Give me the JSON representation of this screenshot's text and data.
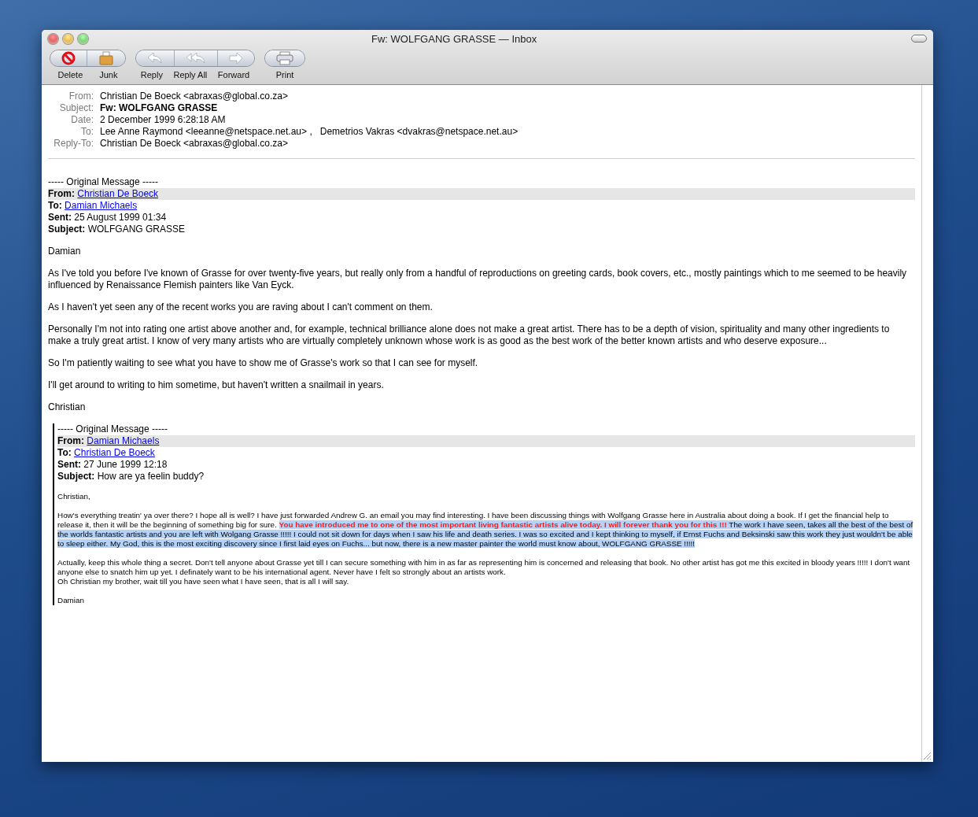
{
  "window": {
    "title": "Fw: WOLFGANG GRASSE — Inbox"
  },
  "toolbar": [
    {
      "buttons": [
        {
          "label": "Delete"
        },
        {
          "label": "Junk"
        }
      ]
    },
    {
      "buttons": [
        {
          "label": "Reply"
        },
        {
          "label": "Reply All"
        },
        {
          "label": "Forward"
        }
      ]
    },
    {
      "buttons": [
        {
          "label": "Print"
        }
      ]
    }
  ],
  "headers": [
    {
      "label": "From:",
      "value": "Christian De Boeck <abraxas@global.co.za>",
      "bold": false
    },
    {
      "label": "Subject:",
      "value": "Fw: WOLFGANG GRASSE",
      "bold": true
    },
    {
      "label": "Date:",
      "value": "2 December 1999 6:28:18 AM",
      "bold": false
    },
    {
      "label": "To:",
      "value": "Lee Anne Raymond <leeanne@netspace.net.au> ,   Demetrios Vakras <dvakras@netspace.net.au>",
      "bold": false
    },
    {
      "label": "Reply-To:",
      "value": "Christian De Boeck <abraxas@global.co.za>",
      "bold": false
    }
  ],
  "message": {
    "intro": "----- Original Message -----",
    "quote_headers": [
      {
        "label": "From:",
        "value": "Christian De Boeck",
        "link": true,
        "highlighted": true
      },
      {
        "label": "To:",
        "value": "Damian Michaels",
        "link": true,
        "highlighted": false
      },
      {
        "label": "Sent:",
        "value": "25 August 1999 01:34",
        "link": false,
        "highlighted": false
      },
      {
        "label": "Subject:",
        "value": "WOLFGANG GRASSE",
        "link": false,
        "highlighted": false
      }
    ],
    "paragraphs": [
      "Damian",
      "As I've told you before I've known of Grasse for over twenty-five years, but really only from a handful of reproductions on greeting cards, book covers, etc., mostly paintings which to me seemed to be heavily influenced by Renaissance Flemish painters like Van Eyck.",
      "As I haven't yet seen any of the recent works you are raving about I can't comment on them.",
      "Personally I'm not into rating one artist above another and, for example, technical brilliance alone does not make a great artist. There has to be a depth of vision, spirituality and many other ingredients to make a truly great artist. I know of very many artists who are virtually completely unknown whose work is as good as the best work of the better known artists and who deserve exposure...",
      "So I'm patiently waiting to see what you have to show me of Grasse's work so that I can see for myself.",
      "I'll get around to writing to him sometime, but haven't written a snailmail in years.",
      "Christian"
    ],
    "quoted": {
      "intro": "----- Original Message -----",
      "quote_headers": [
        {
          "label": "From:",
          "value": "Damian Michaels",
          "link": true,
          "highlighted": true
        },
        {
          "label": "To:",
          "value": "Christian De Boeck",
          "link": true,
          "highlighted": false
        },
        {
          "label": "Sent:",
          "value": "27 June 1999 12:18",
          "link": false,
          "highlighted": false
        },
        {
          "label": "Subject:",
          "value": "How are ya feelin buddy?",
          "link": false,
          "highlighted": false
        }
      ],
      "paragraphs": [
        {
          "segments": [
            {
              "text": "Christian,",
              "emphasis": false,
              "selected": false
            }
          ]
        },
        {
          "segments": [
            {
              "text": "How's everything treatin' ya over there? I hope all is well? I have just forwarded Andrew G. an email you may find interesting. I have been discussing things with Wolfgang Grasse here in Australia about doing a book. If I get the financial help to release it, then it will be the beginning of something big for sure. ",
              "emphasis": false,
              "selected": false
            },
            {
              "text": "You have introduced me to one of the most important living fantastic artists alive today. I will forever thank you for this !!!",
              "emphasis": true,
              "selected": true
            },
            {
              "text": " The work I have seen, takes all the best of the best of the worlds fantastic artists and you are left with Wolgang Grasse !!!!! I could not sit down for days when I saw his life and death series. I was so excited and I kept thinking to myself, if Ernst Fuchs and Beksinski saw this work they just wouldn't be able to sleep either. My God, this is the most exciting discovery since I first laid eyes on Fuchs... but now, there is a new master painter the world must know about, WOLFGANG GRASSE !!!!!",
              "emphasis": false,
              "selected": true
            }
          ]
        },
        {
          "segments": [
            {
              "text": "Actually, keep this whole thing a secret. Don't tell anyone about Grasse yet till I can secure something with him in as far as representing him is concerned and releasing that book. No other artist has got me this excited in bloody years !!!!! I don't want anyone else to snatch him up yet. I definately want to be his international agent. Never have I felt so strongly about an artists work.\nOh Christian my brother, wait till you have seen what I have seen, that is all I will say.",
              "emphasis": false,
              "selected": false
            }
          ]
        },
        {
          "segments": [
            {
              "text": "Damian",
              "emphasis": false,
              "selected": false
            }
          ]
        }
      ]
    }
  }
}
